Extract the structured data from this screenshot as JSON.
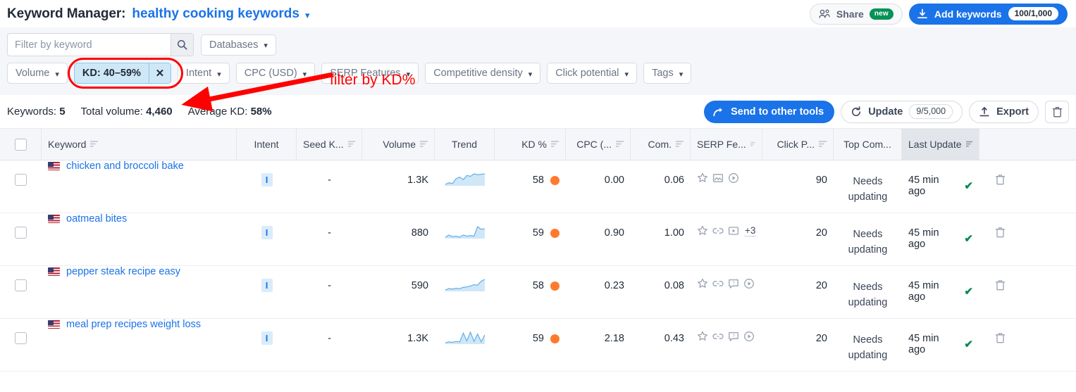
{
  "header": {
    "app_title": "Keyword Manager:",
    "project_name": "healthy cooking keywords",
    "caret_icon": "chevron-down-icon",
    "share_label": "Share",
    "share_badge": "new",
    "share_icon": "people-icon",
    "add_keywords_label": "Add keywords",
    "add_keywords_count": "100/1,000",
    "add_keywords_icon": "download-icon"
  },
  "filters": {
    "search_placeholder": "Filter by keyword",
    "search_value": "",
    "search_icon": "search-icon",
    "databases_label": "Databases",
    "volume_label": "Volume",
    "kd_label": "KD: 40–59%",
    "kd_clear_icon": "close-icon",
    "intent_label": "Intent",
    "cpc_label": "CPC (USD)",
    "serp_features_label": "SERP Features",
    "competitive_density_label": "Competitive density",
    "click_potential_label": "Click potential",
    "tags_label": "Tags"
  },
  "annotation": {
    "text": "filter by KD%",
    "color": "#ff0000"
  },
  "summary": {
    "keywords_label": "Keywords:",
    "keywords_value": "5",
    "total_volume_label": "Total volume:",
    "total_volume_value": "4,460",
    "average_kd_label": "Average KD:",
    "average_kd_value": "58%",
    "send_to_other_tools_label": "Send to other tools",
    "send_icon": "share-arrow-icon",
    "update_label": "Update",
    "update_count": "9/5,000",
    "update_icon": "refresh-icon",
    "export_label": "Export",
    "export_icon": "upload-icon",
    "delete_icon": "trash-icon"
  },
  "table": {
    "columns": [
      {
        "key": "check",
        "label": "",
        "sortable": false,
        "align": "ctr"
      },
      {
        "key": "keyword",
        "label": "Keyword",
        "sortable": true,
        "align": "left"
      },
      {
        "key": "intent",
        "label": "Intent",
        "sortable": false,
        "align": "ctr"
      },
      {
        "key": "seed",
        "label": "Seed K...",
        "sortable": true,
        "align": "ctr"
      },
      {
        "key": "volume",
        "label": "Volume",
        "sortable": true,
        "align": "num"
      },
      {
        "key": "trend",
        "label": "Trend",
        "sortable": false,
        "align": "ctr"
      },
      {
        "key": "kd",
        "label": "KD %",
        "sortable": true,
        "align": "num"
      },
      {
        "key": "cpc",
        "label": "CPC (...",
        "sortable": true,
        "align": "num"
      },
      {
        "key": "com",
        "label": "Com.",
        "sortable": true,
        "align": "num"
      },
      {
        "key": "serp",
        "label": "SERP Fe...",
        "sortable": true,
        "align": "left"
      },
      {
        "key": "click",
        "label": "Click P...",
        "sortable": true,
        "align": "num"
      },
      {
        "key": "topcom",
        "label": "Top Com...",
        "sortable": false,
        "align": "ctr"
      },
      {
        "key": "last",
        "label": "Last Update",
        "sortable": true,
        "align": "num"
      },
      {
        "key": "del",
        "label": "",
        "sortable": false,
        "align": "ctr"
      }
    ],
    "rows": [
      {
        "keyword": "chicken and broccoli bake",
        "flag": "us-flag-icon",
        "intent": "I",
        "seed": "-",
        "volume": "1.3K",
        "trend": "8,12,10,22,26,20,30,28,34,32,33,34",
        "kd": "58",
        "kd_color": "#ff7a2f",
        "cpc": "0.00",
        "com": "0.06",
        "serp_icons": [
          "star-icon",
          "image-icon",
          "video-play-icon"
        ],
        "serp_more": "",
        "click": "90",
        "topcom": "Needs updating",
        "last_update": "45 min ago",
        "updated_icon": "check-icon",
        "delete_icon": "trash-icon"
      },
      {
        "keyword": "oatmeal bites",
        "flag": "us-flag-icon",
        "intent": "I",
        "seed": "-",
        "volume": "880",
        "trend": "10,14,11,12,10,14,12,13,12,30,25,26",
        "kd": "59",
        "kd_color": "#ff7a2f",
        "cpc": "0.90",
        "com": "1.00",
        "serp_icons": [
          "star-icon",
          "link-icon",
          "video-box-icon"
        ],
        "serp_more": "+3",
        "click": "20",
        "topcom": "Needs updating",
        "last_update": "45 min ago",
        "updated_icon": "check-icon",
        "delete_icon": "trash-icon"
      },
      {
        "keyword": "pepper steak recipe easy",
        "flag": "us-flag-icon",
        "intent": "I",
        "seed": "-",
        "volume": "590",
        "trend": "6,9,8,10,9,12,13,15,18,17,26,30",
        "kd": "58",
        "kd_color": "#ff7a2f",
        "cpc": "0.23",
        "com": "0.08",
        "serp_icons": [
          "star-icon",
          "link-icon",
          "question-box-icon",
          "video-play-icon"
        ],
        "serp_more": "",
        "click": "20",
        "topcom": "Needs updating",
        "last_update": "45 min ago",
        "updated_icon": "check-icon",
        "delete_icon": "trash-icon"
      },
      {
        "keyword": "meal prep recipes weight loss",
        "flag": "us-flag-icon",
        "intent": "I",
        "seed": "-",
        "volume": "1.3K",
        "trend": "6,8,7,9,8,28,10,30,9,26,8,24",
        "kd": "59",
        "kd_color": "#ff7a2f",
        "cpc": "2.18",
        "com": "0.43",
        "serp_icons": [
          "star-icon",
          "link-icon",
          "question-box-icon",
          "video-play-icon"
        ],
        "serp_more": "",
        "click": "20",
        "topcom": "Needs updating",
        "last_update": "45 min ago",
        "updated_icon": "check-icon",
        "delete_icon": "trash-icon"
      }
    ]
  },
  "colors": {
    "accent": "#1a73e8",
    "kd_orange": "#ff7a2f",
    "annotation_red": "#ff0000",
    "badge_green": "#079256",
    "filter_bg": "#f5f6f9"
  }
}
